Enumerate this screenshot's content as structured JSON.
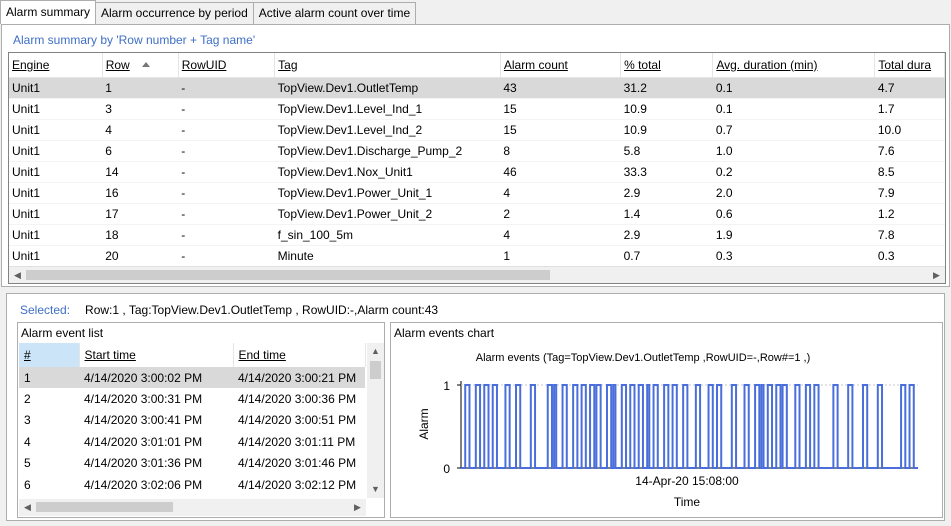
{
  "tabs": [
    {
      "label": "Alarm summary"
    },
    {
      "label": "Alarm occurrence by period"
    },
    {
      "label": "Active alarm count over time"
    }
  ],
  "summary": {
    "title": "Alarm summary by 'Row number + Tag name'",
    "columns": [
      "Engine",
      "Row",
      "RowUID",
      "Tag",
      "Alarm count",
      "% total",
      "Avg. duration (min)",
      "Total dura"
    ],
    "rows": [
      [
        "Unit1",
        "1",
        "-",
        "TopView.Dev1.OutletTemp",
        "43",
        "31.2",
        "0.1",
        "4.7"
      ],
      [
        "Unit1",
        "3",
        "-",
        "TopView.Dev1.Level_Ind_1",
        "15",
        "10.9",
        "0.1",
        "1.7"
      ],
      [
        "Unit1",
        "4",
        "-",
        "TopView.Dev1.Level_Ind_2",
        "15",
        "10.9",
        "0.7",
        "10.0"
      ],
      [
        "Unit1",
        "6",
        "-",
        "TopView.Dev1.Discharge_Pump_2",
        "8",
        "5.8",
        "1.0",
        "7.6"
      ],
      [
        "Unit1",
        "14",
        "-",
        "TopView.Dev1.Nox_Unit1",
        "46",
        "33.3",
        "0.2",
        "8.5"
      ],
      [
        "Unit1",
        "16",
        "-",
        "TopView.Dev1.Power_Unit_1",
        "4",
        "2.9",
        "2.0",
        "7.9"
      ],
      [
        "Unit1",
        "17",
        "-",
        "TopView.Dev1.Power_Unit_2",
        "2",
        "1.4",
        "0.6",
        "1.2"
      ],
      [
        "Unit1",
        "18",
        "-",
        "f_sin_100_5m",
        "4",
        "2.9",
        "1.9",
        "7.8"
      ],
      [
        "Unit1",
        "20",
        "-",
        "Minute",
        "1",
        "0.7",
        "0.3",
        "0.3"
      ]
    ],
    "selected_row_index": 0
  },
  "selected": {
    "label": "Selected:",
    "text": "Row:1 , Tag:TopView.Dev1.OutletTemp , RowUID:-,Alarm count:43"
  },
  "event_list": {
    "title": "Alarm event list",
    "columns": [
      "#",
      "Start time",
      "End time"
    ],
    "rows": [
      [
        "1",
        "4/14/2020 3:00:02 PM",
        "4/14/2020 3:00:21 PM"
      ],
      [
        "2",
        "4/14/2020 3:00:31 PM",
        "4/14/2020 3:00:36 PM"
      ],
      [
        "3",
        "4/14/2020 3:00:41 PM",
        "4/14/2020 3:00:51 PM"
      ],
      [
        "4",
        "4/14/2020 3:01:01 PM",
        "4/14/2020 3:01:11 PM"
      ],
      [
        "5",
        "4/14/2020 3:01:36 PM",
        "4/14/2020 3:01:46 PM"
      ],
      [
        "6",
        "4/14/2020 3:02:06 PM",
        "4/14/2020 3:02:12 PM"
      ]
    ]
  },
  "chart_panel": {
    "title": "Alarm events chart"
  },
  "colors": {
    "accent_text": "#3e6fc6",
    "series": "#4a6fdc",
    "selected_row": "#d9d9d9",
    "header_highlight": "#cce4f7"
  },
  "chart_data": {
    "type": "line",
    "title": "Alarm events (Tag=TopView.Dev1.OutletTemp ,RowUID=-,Row#=1 ,)",
    "xlabel": "Time",
    "ylabel": "Alarm",
    "x_tick_labels": [
      "14-Apr-20 15:08:00"
    ],
    "y_ticks": [
      0,
      1
    ],
    "ylim": [
      0,
      1
    ],
    "step": true,
    "grid": false,
    "series": [
      {
        "events": [
          [
            2,
            4
          ],
          [
            7,
            9
          ],
          [
            11,
            13
          ],
          [
            15,
            17
          ],
          [
            21,
            23
          ],
          [
            26,
            28
          ],
          [
            33,
            35
          ],
          [
            41,
            43
          ],
          [
            44,
            45
          ],
          [
            48,
            50
          ],
          [
            53,
            55
          ],
          [
            57,
            59
          ],
          [
            61,
            63
          ],
          [
            64,
            66
          ],
          [
            69,
            71
          ],
          [
            72,
            73
          ],
          [
            76,
            78
          ],
          [
            80,
            82
          ],
          [
            84,
            86
          ],
          [
            88,
            89
          ],
          [
            91,
            93
          ],
          [
            96,
            98
          ],
          [
            100,
            102
          ],
          [
            105,
            107
          ],
          [
            111,
            113
          ],
          [
            117,
            119
          ],
          [
            121,
            123
          ],
          [
            128,
            130
          ],
          [
            134,
            136
          ],
          [
            139,
            141
          ],
          [
            142,
            143
          ],
          [
            145,
            147
          ],
          [
            149,
            151
          ],
          [
            152,
            154
          ],
          [
            158,
            160
          ],
          [
            163,
            165
          ],
          [
            167,
            169
          ],
          [
            176,
            178
          ],
          [
            183,
            185
          ],
          [
            190,
            192
          ],
          [
            197,
            199
          ],
          [
            208,
            210
          ],
          [
            212,
            214
          ]
        ]
      }
    ]
  }
}
